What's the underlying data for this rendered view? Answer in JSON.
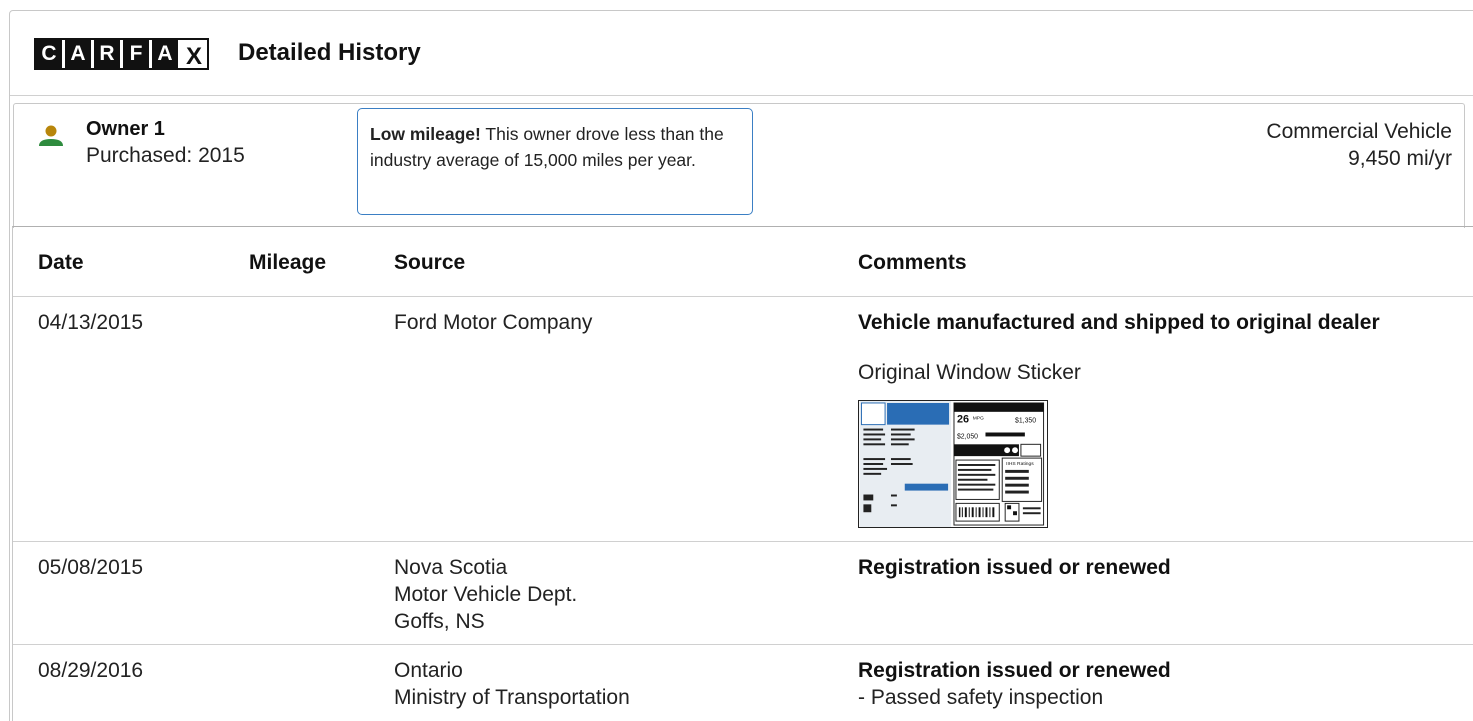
{
  "header": {
    "logo_letters": [
      "C",
      "A",
      "R",
      "F",
      "A",
      "X"
    ],
    "title": "Detailed History"
  },
  "owner": {
    "name": "Owner 1",
    "purchased": "Purchased: 2015",
    "note_bold": "Low mileage!",
    "note_text": " This owner drove less than the industry average of 15,000 miles per year.",
    "vehicle_type": "Commercial Vehicle",
    "miles_per_year": "9,450 mi/yr",
    "icon": "person-icon",
    "colors": {
      "head": "#b8860b",
      "body": "#2e8b3e",
      "note_border": "#3b7fc4"
    }
  },
  "table": {
    "columns": {
      "date": "Date",
      "mileage": "Mileage",
      "source": "Source",
      "comments": "Comments"
    },
    "rows": [
      {
        "date": "04/13/2015",
        "mileage": "",
        "source": [
          "Ford Motor Company"
        ],
        "comment_title": "Vehicle manufactured and shipped to original dealer",
        "comment_extra": "Original Window Sticker",
        "sticker": {
          "mpg": "26",
          "mpg_unit": "MPG",
          "save": "$1,350",
          "cost": "$2,050",
          "ratings": "IIHS Ratings"
        }
      },
      {
        "date": "05/08/2015",
        "mileage": "",
        "source": [
          "Nova Scotia",
          "Motor Vehicle Dept.",
          "Goffs, NS"
        ],
        "comment_title": "Registration issued or renewed",
        "comment_extra": ""
      },
      {
        "date": "08/29/2016",
        "mileage": "",
        "source": [
          "Ontario",
          "Ministry of Transportation"
        ],
        "comment_title": "Registration issued or renewed",
        "comment_extra": "- Passed safety inspection"
      }
    ]
  }
}
